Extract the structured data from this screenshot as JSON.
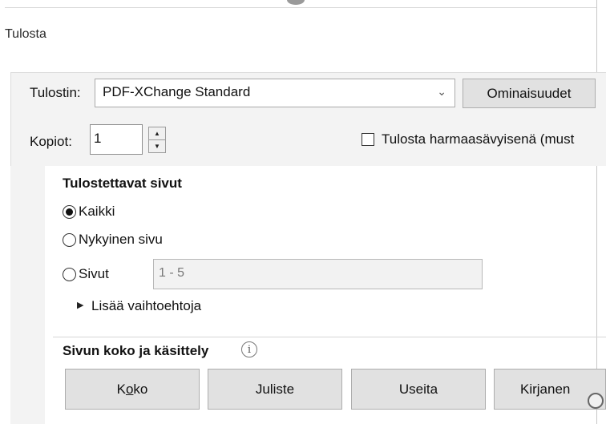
{
  "window": {
    "title": "Tulosta"
  },
  "printer": {
    "label": "Tulostin:",
    "selected": "PDF-XChange Standard",
    "properties_button": "Ominaisuudet"
  },
  "copies": {
    "label": "Kopiot:",
    "value": "1"
  },
  "grayscale": {
    "label": "Tulosta harmaasävyisenä (must",
    "checked": false
  },
  "pages_group": {
    "title": "Tulostettavat sivut",
    "options": [
      {
        "label": "Kaikki",
        "checked": true
      },
      {
        "label": "Nykyinen sivu",
        "checked": false
      },
      {
        "label": "Sivut",
        "checked": false
      }
    ],
    "range_placeholder": "1 - 5",
    "more_options": "Lisää vaihtoehtoja"
  },
  "page_size_group": {
    "title": "Sivun koko ja käsittely",
    "buttons": {
      "size_pre": "K",
      "size_underlined": "o",
      "size_post": "ko",
      "poster": "Juliste",
      "multiple": "Useita",
      "booklet": "Kirjanen"
    }
  },
  "icons": {
    "dropdown": "chevron-down-icon",
    "spin_up": "triangle-up-icon",
    "spin_down": "triangle-down-icon",
    "expand": "triangle-right-icon",
    "info": "info-icon",
    "cursor": "busy-cursor-icon"
  }
}
